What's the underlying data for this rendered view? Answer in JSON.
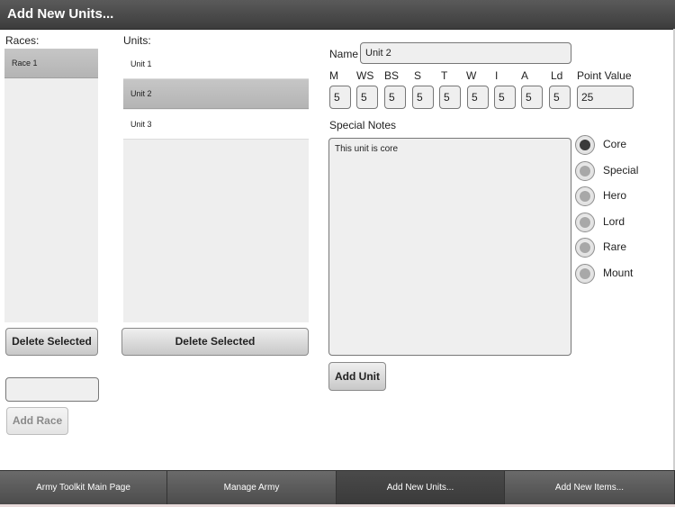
{
  "header": {
    "title": "Add New Units..."
  },
  "races": {
    "label": "Races:",
    "items": [
      {
        "label": "Race 1",
        "selected": true
      }
    ],
    "delete_label": "Delete Selected",
    "new_race_value": "",
    "add_label": "Add Race"
  },
  "units": {
    "label": "Units:",
    "items": [
      {
        "label": "Unit 1",
        "selected": false
      },
      {
        "label": "Unit 2",
        "selected": true
      },
      {
        "label": "Unit 3",
        "selected": false
      }
    ],
    "delete_label": "Delete Selected"
  },
  "editor": {
    "name_label": "Name",
    "name_value": "Unit 2",
    "stats": [
      {
        "label": "M",
        "value": "5"
      },
      {
        "label": "WS",
        "value": "5"
      },
      {
        "label": "BS",
        "value": "5"
      },
      {
        "label": "S",
        "value": "5"
      },
      {
        "label": "T",
        "value": "5"
      },
      {
        "label": "W",
        "value": "5"
      },
      {
        "label": "I",
        "value": "5"
      },
      {
        "label": "A",
        "value": "5"
      },
      {
        "label": "Ld",
        "value": "5"
      }
    ],
    "point_value_label": "Point Value",
    "point_value": "25",
    "notes_label": "Special Notes",
    "notes_value": "This unit is core",
    "unit_types": [
      {
        "label": "Core",
        "checked": true
      },
      {
        "label": "Special",
        "checked": false
      },
      {
        "label": "Hero",
        "checked": false
      },
      {
        "label": "Lord",
        "checked": false
      },
      {
        "label": "Rare",
        "checked": false
      },
      {
        "label": "Mount",
        "checked": false
      }
    ],
    "add_unit_label": "Add Unit"
  },
  "tabs": [
    {
      "label": "Army Toolkit Main Page",
      "active": false
    },
    {
      "label": "Manage Army",
      "active": false
    },
    {
      "label": "Add New Units...",
      "active": true
    },
    {
      "label": "Add New Items...",
      "active": false
    }
  ]
}
